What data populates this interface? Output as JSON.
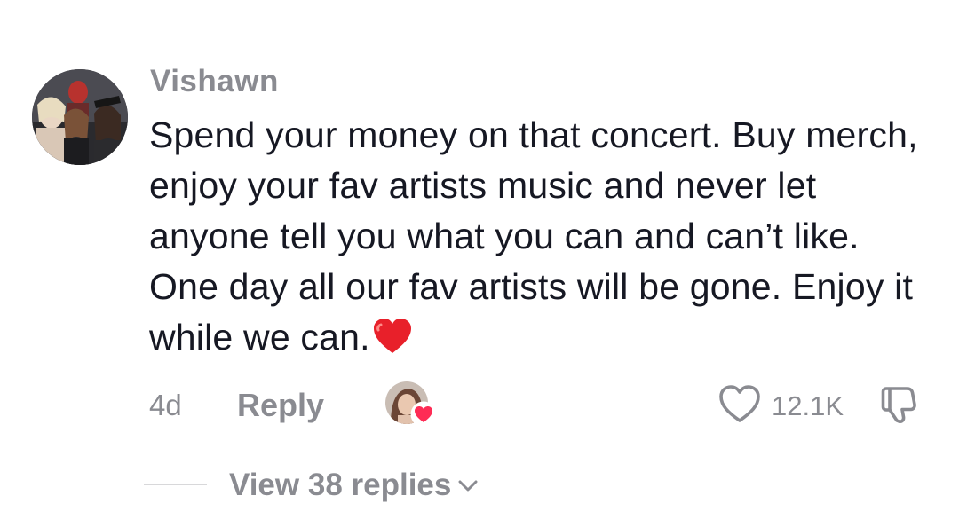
{
  "comment": {
    "username": "Vishawn",
    "text": "Spend your money on that concert. Buy merch, enjoy your fav artists music and never let anyone tell you what you can and can’t like. One day all our fav artists will be gone. Enjoy it while we can.",
    "emoji": "red-heart-emoji",
    "timestamp": "4d",
    "reply_label": "Reply",
    "like_count": "12.1K",
    "liked_by_creator": true,
    "replies_label": "View 38 replies"
  },
  "icons": {
    "avatar": "user-avatar",
    "creator_avatar": "creator-avatar",
    "creator_heart": "heart-icon",
    "like": "heart-outline-icon",
    "dislike": "thumbs-down-outline-icon",
    "chevron": "chevron-down-icon"
  },
  "colors": {
    "text_primary": "#161823",
    "text_secondary": "#8a8b91",
    "creator_heart": "#fe2c55",
    "emoji_heart": "#e8202a",
    "background": "#ffffff"
  }
}
